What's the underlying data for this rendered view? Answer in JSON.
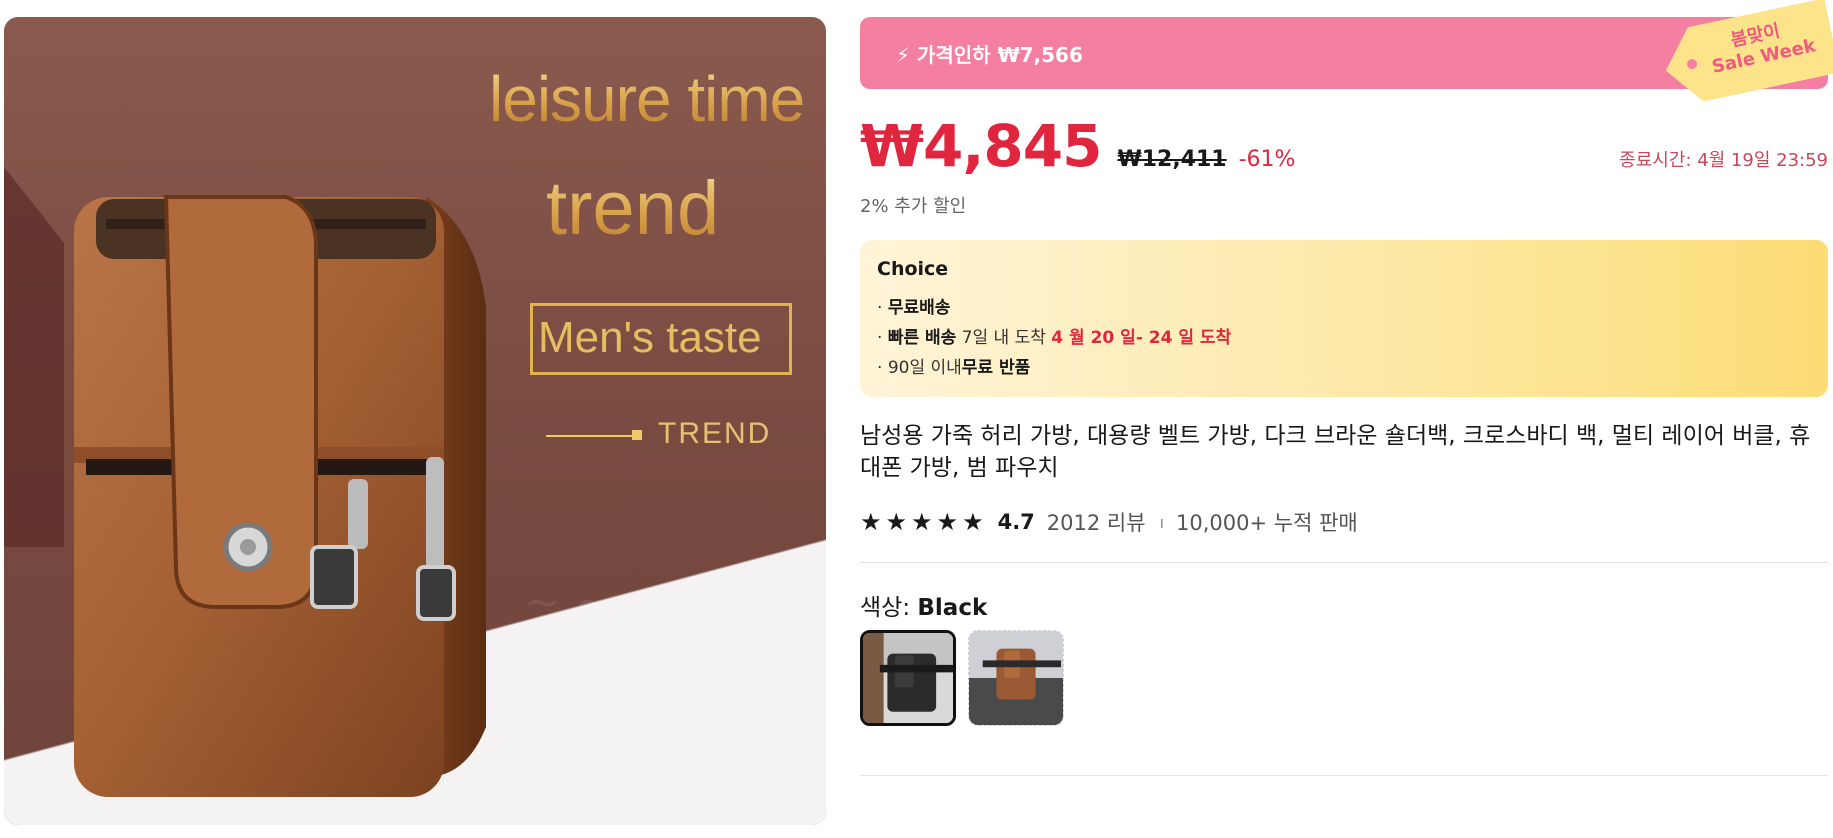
{
  "hero": {
    "headline_1": "leisure time",
    "headline_2": "trend",
    "taste": "Men's taste",
    "trend_small": "TREND"
  },
  "banner": {
    "text": "⚡ 가격인하 ₩7,566",
    "tag_line1": "봄맞이",
    "tag_line2": "Sale Week",
    "color": "#f47fa0"
  },
  "price": {
    "current": "₩4,845",
    "original": "₩12,411",
    "discount": "-61%",
    "end_time": "종료시간: 4월 19일 23:59",
    "extra_discount": "2% 추가 할인"
  },
  "choice": {
    "title": "Choice",
    "line1_bold": "무료배송",
    "line2_bold": "빠른 배송",
    "line2_text": " 7일 내 도착 ",
    "line2_red": "4 월 20 일- 24 일 도착",
    "line3_text": "90일 이내",
    "line3_bold": "무료 반품",
    "bullet": "· "
  },
  "product": {
    "title": "남성용 가죽 허리 가방, 대용량 벨트 가방, 다크 브라운 숄더백, 크로스바디 백, 멀티 레이어 버클, 휴대폰 가방, 범 파우치"
  },
  "rating": {
    "stars": [
      "★",
      "★",
      "★",
      "★",
      "★"
    ],
    "value": "4.7",
    "reviews": "2012 리뷰",
    "separator": "ı",
    "sold": "10,000+ 누적 판매"
  },
  "color": {
    "label": "색상: ",
    "value": "Black",
    "options": [
      "Black",
      "Brown"
    ]
  },
  "accent_red": "#e0263f"
}
